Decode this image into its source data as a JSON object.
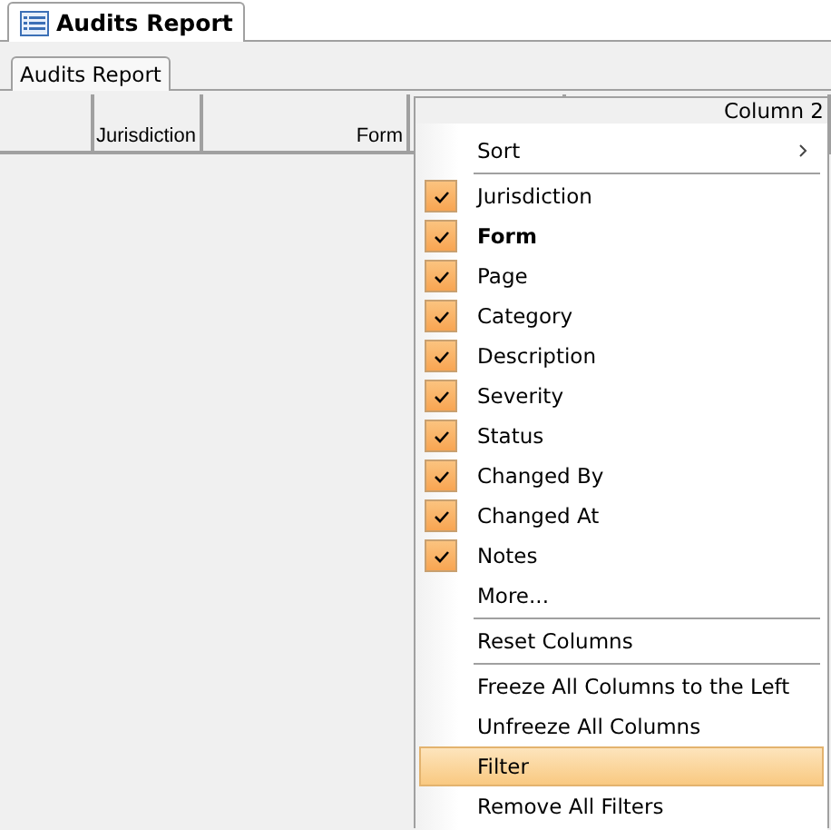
{
  "document_tab": {
    "title": "Audits Report"
  },
  "view_tabs": [
    {
      "label": "Audits Report",
      "selected": true
    }
  ],
  "grid": {
    "columns": [
      "",
      "Jurisdiction",
      "Form",
      "",
      ""
    ]
  },
  "context_menu": {
    "header": "Column 2",
    "items": [
      {
        "kind": "submenu",
        "label": "Sort",
        "selected": false
      },
      {
        "kind": "separator"
      },
      {
        "kind": "check",
        "label": "Jurisdiction",
        "checked": true,
        "current": false
      },
      {
        "kind": "check",
        "label": "Form",
        "checked": true,
        "current": true
      },
      {
        "kind": "check",
        "label": "Page",
        "checked": true,
        "current": false
      },
      {
        "kind": "check",
        "label": "Category",
        "checked": true,
        "current": false
      },
      {
        "kind": "check",
        "label": "Description",
        "checked": true,
        "current": false
      },
      {
        "kind": "check",
        "label": "Severity",
        "checked": true,
        "current": false
      },
      {
        "kind": "check",
        "label": "Status",
        "checked": true,
        "current": false
      },
      {
        "kind": "check",
        "label": "Changed By",
        "checked": true,
        "current": false
      },
      {
        "kind": "check",
        "label": "Changed At",
        "checked": true,
        "current": false
      },
      {
        "kind": "check",
        "label": "Notes",
        "checked": true,
        "current": false
      },
      {
        "kind": "command",
        "label": "More...",
        "selected": false
      },
      {
        "kind": "separator"
      },
      {
        "kind": "command",
        "label": "Reset Columns",
        "selected": false
      },
      {
        "kind": "separator"
      },
      {
        "kind": "command",
        "label": "Freeze All Columns to the Left",
        "selected": false
      },
      {
        "kind": "command",
        "label": "Unfreeze All Columns",
        "selected": false
      },
      {
        "kind": "command",
        "label": "Filter",
        "selected": true
      },
      {
        "kind": "command",
        "label": "Remove All Filters",
        "selected": false
      }
    ]
  }
}
